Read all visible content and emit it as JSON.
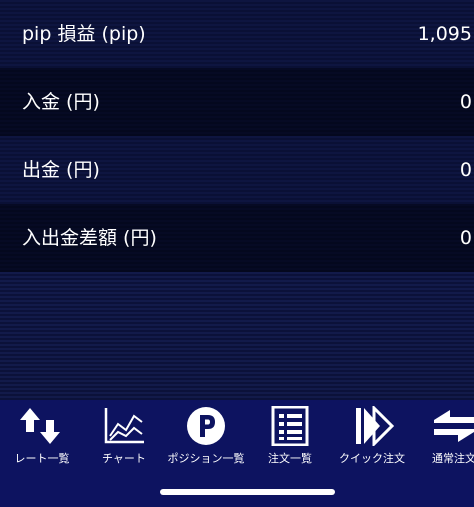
{
  "rows": [
    {
      "label": "pip 損益 (pip)",
      "value": "1,095"
    },
    {
      "label": "入金 (円)",
      "value": "0"
    },
    {
      "label": "出金 (円)",
      "value": "0"
    },
    {
      "label": "入出金差額 (円)",
      "value": "0"
    }
  ],
  "tabs": [
    {
      "label": "レート一覧",
      "icon": "up-down-arrows-icon"
    },
    {
      "label": "チャート",
      "icon": "chart-icon"
    },
    {
      "label": "ポジション一覧",
      "icon": "position-p-icon"
    },
    {
      "label": "注文一覧",
      "icon": "order-list-icon"
    },
    {
      "label": "クイック注文",
      "icon": "quick-order-icon"
    },
    {
      "label": "通常注文",
      "icon": "normal-order-icon"
    }
  ],
  "colors": {
    "background": "#0c1238",
    "tabbar": "#0d1360",
    "text": "#ffffff"
  }
}
